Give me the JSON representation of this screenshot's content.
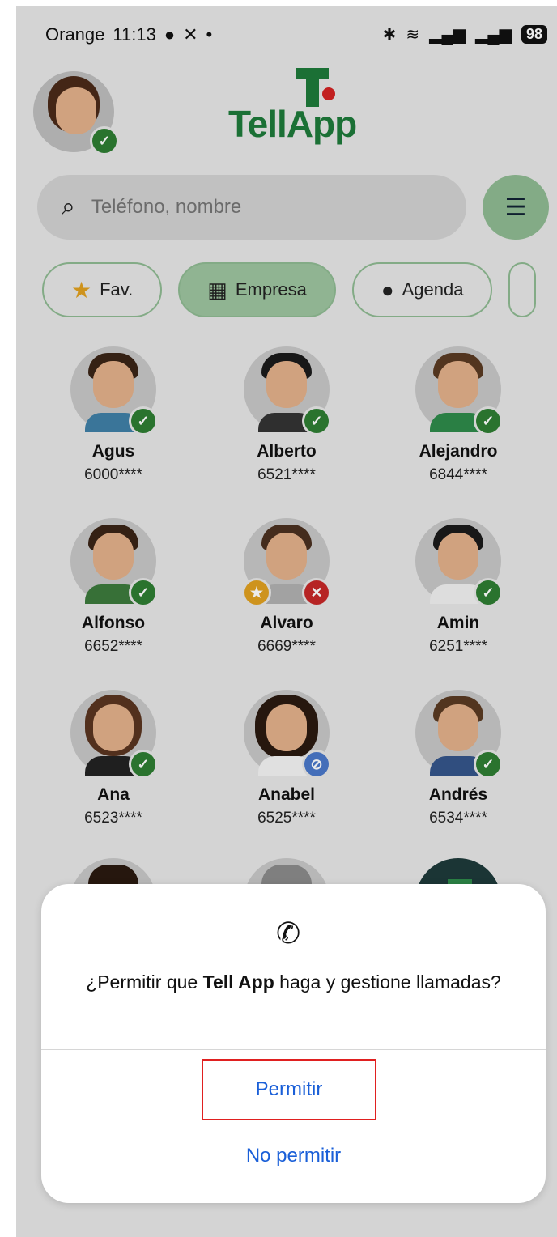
{
  "status_bar": {
    "carrier": "Orange",
    "time": "11:13",
    "battery": "98"
  },
  "app": {
    "logo_text": "TellApp"
  },
  "search": {
    "placeholder": "Teléfono, nombre"
  },
  "tabs": [
    {
      "label": "Fav.",
      "icon": "star-icon",
      "active": false
    },
    {
      "label": "Empresa",
      "icon": "building-icon",
      "active": true
    },
    {
      "label": "Agenda",
      "icon": "person-icon",
      "active": false
    }
  ],
  "contacts": [
    {
      "name": "Agus",
      "number": "6000****",
      "status": "online"
    },
    {
      "name": "Alberto",
      "number": "6521****",
      "status": "online"
    },
    {
      "name": "Alejandro",
      "number": "6844****",
      "status": "online"
    },
    {
      "name": "Alfonso",
      "number": "6652****",
      "status": "online"
    },
    {
      "name": "Alvaro",
      "number": "6669****",
      "status": "busy",
      "favorite": true
    },
    {
      "name": "Amin",
      "number": "6251****",
      "status": "online"
    },
    {
      "name": "Ana",
      "number": "6523****",
      "status": "online"
    },
    {
      "name": "Anabel",
      "number": "6525****",
      "status": "blocked"
    },
    {
      "name": "Andrés",
      "number": "6534****",
      "status": "online"
    }
  ],
  "dialog": {
    "message_prefix": "¿Permitir que ",
    "app_name": "Tell App",
    "message_suffix": " haga y gestione llamadas?",
    "allow": "Permitir",
    "deny": "No permitir"
  },
  "colors": {
    "brand_green": "#1e7a3a",
    "accent_red": "#d32323",
    "link_blue": "#1a5fd8",
    "highlight_red": "#e02020"
  }
}
